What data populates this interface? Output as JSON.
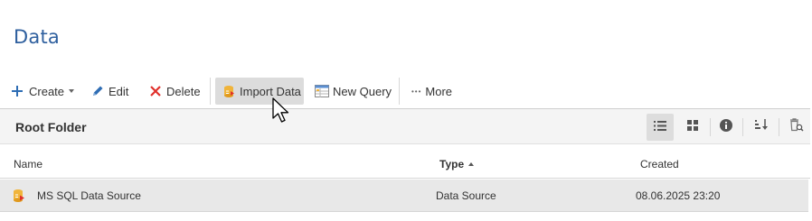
{
  "page": {
    "title": "Data"
  },
  "toolbar": {
    "create_label": "Create",
    "edit_label": "Edit",
    "delete_label": "Delete",
    "import_label": "Import Data",
    "new_query_label": "New Query",
    "more_label": "More",
    "more_icon_glyph": "•••"
  },
  "folder": {
    "title": "Root Folder",
    "view_buttons": [
      "list-view-icon",
      "grid-view-icon",
      "info-icon",
      "sort-icon",
      "recycle-bin-search-icon"
    ]
  },
  "grid": {
    "columns": [
      {
        "label": "Name"
      },
      {
        "label": "Type",
        "sorted": "ascending"
      },
      {
        "label": "Created"
      }
    ],
    "rows": [
      {
        "name": "MS SQL Data Source",
        "type": "Data Source",
        "created": "08.06.2025 23:20",
        "icon": "data-source-icon"
      }
    ]
  },
  "colors": {
    "title": "#2e5f9e",
    "accent_blue": "#2e6db4",
    "delete_red": "#e0302b",
    "active_bg": "#dcdcdc",
    "row_selected_bg": "#e8e8e8"
  }
}
